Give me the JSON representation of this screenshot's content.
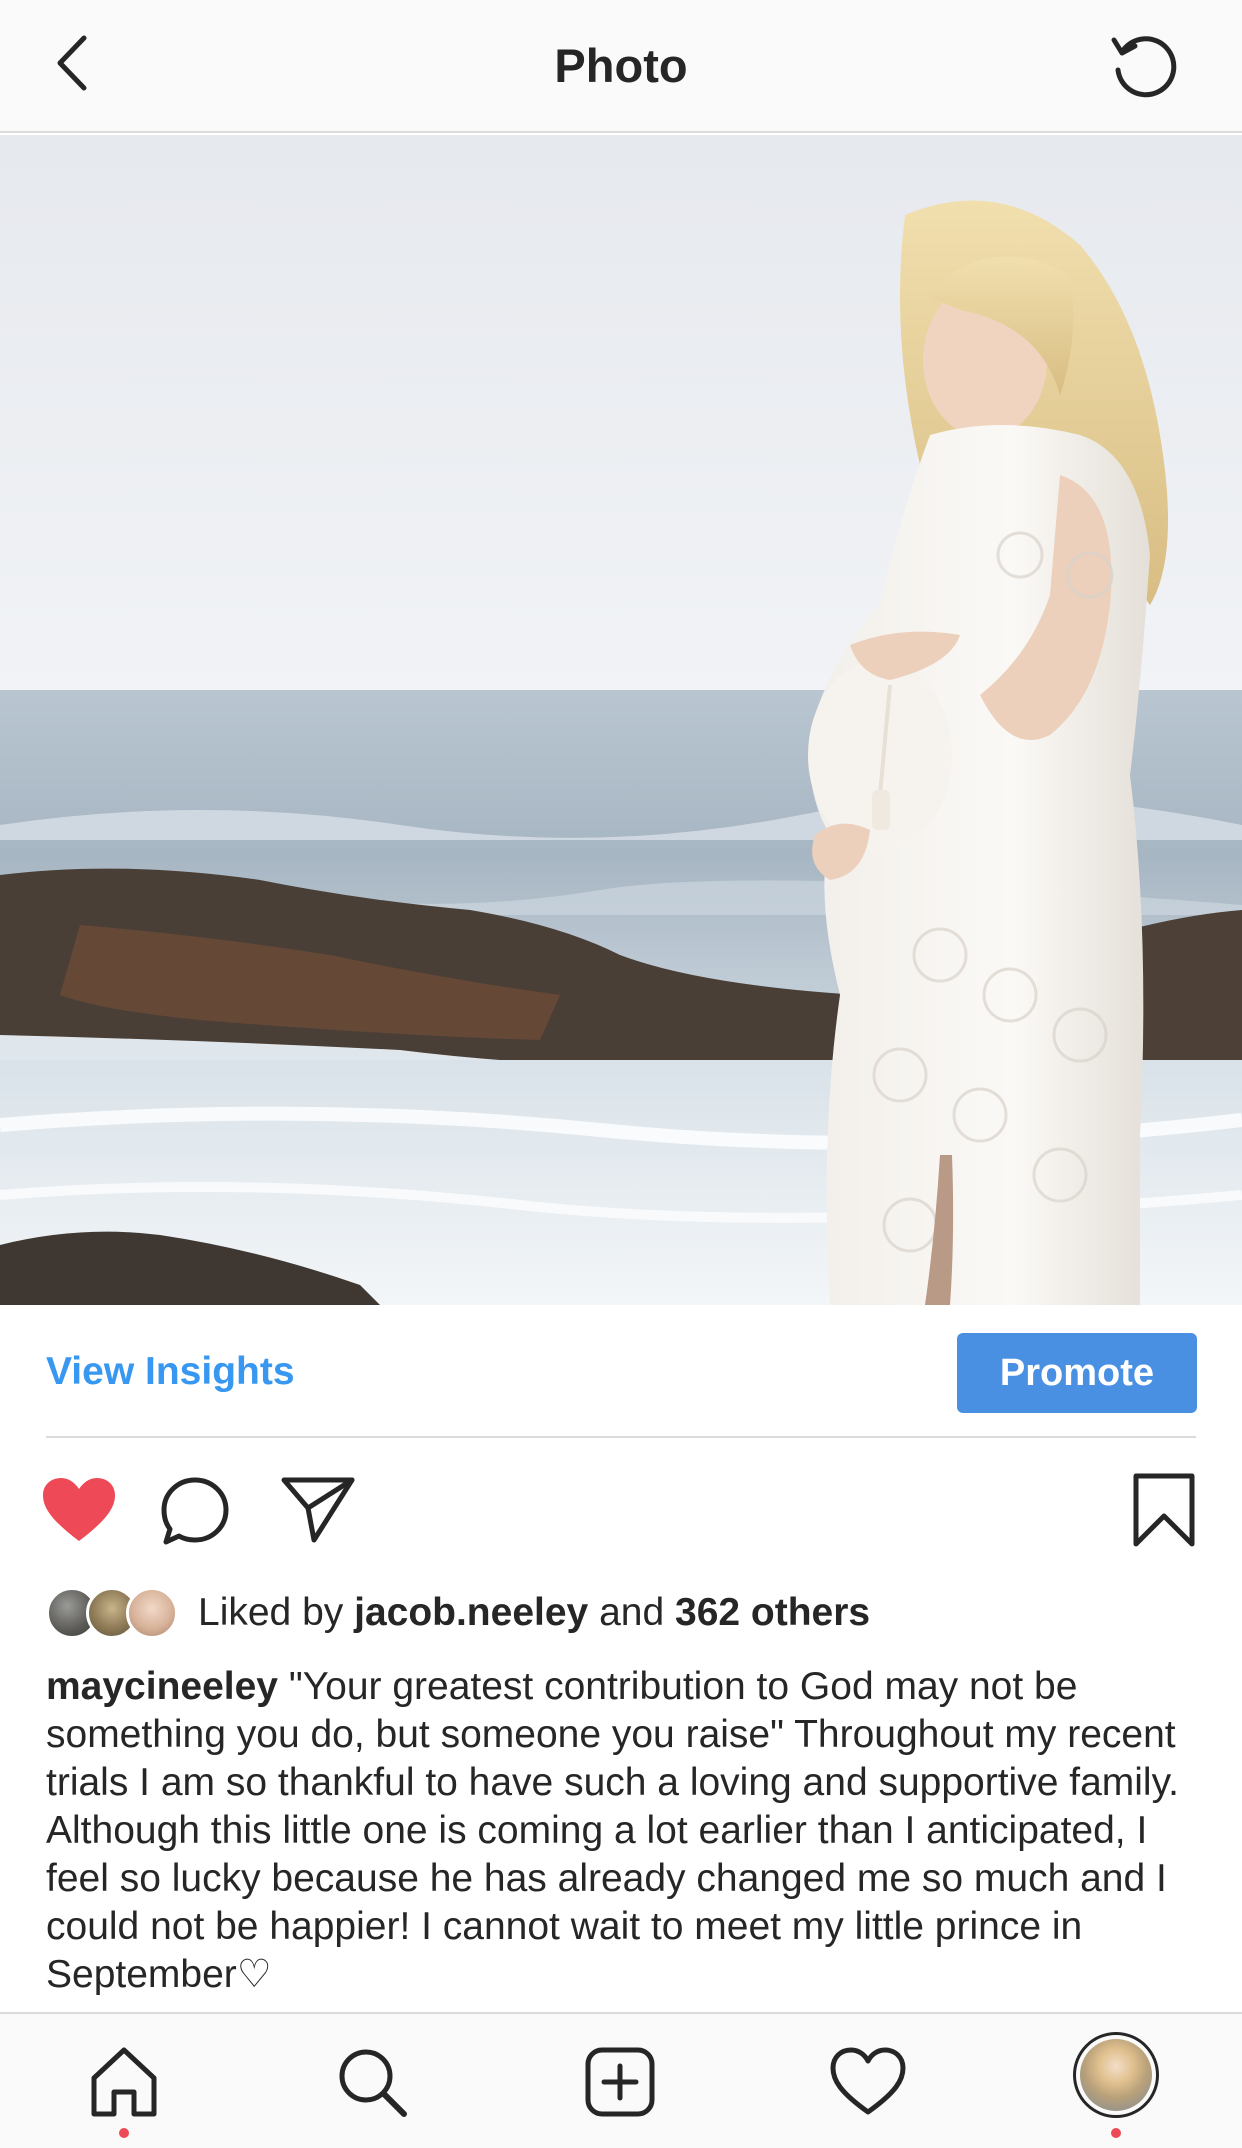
{
  "header": {
    "title": "Photo",
    "back_icon": "chevron-left-icon",
    "refresh_icon": "refresh-icon"
  },
  "photo": {
    "image": "post-photo"
  },
  "insights": {
    "view_insights_label": "View Insights",
    "promote_label": "Promote"
  },
  "actions": {
    "liked": true,
    "like_color": "#ed4956"
  },
  "likes": {
    "prefix": "Liked by",
    "user": "jacob.neeley",
    "connector": "and",
    "others": "362 others"
  },
  "caption": {
    "username": "maycineeley",
    "text": "\"Your greatest contribution to God may not be something you do, but someone you raise\" Throughout my recent trials I am so thankful to have such a loving and supportive family. Although this little one is coming a lot earlier than I anticipated, I feel so lucky because he has already changed me so much and I could not be happier! I cannot wait to meet my little prince in September♡"
  },
  "tabbar": {
    "items": [
      "home-icon",
      "search-icon",
      "add-post-icon",
      "activity-heart-icon",
      "profile-avatar"
    ]
  },
  "colors": {
    "accent_blue": "#3897f0",
    "promote_bg": "#4a90e2",
    "notification_dot": "#ed4956"
  }
}
